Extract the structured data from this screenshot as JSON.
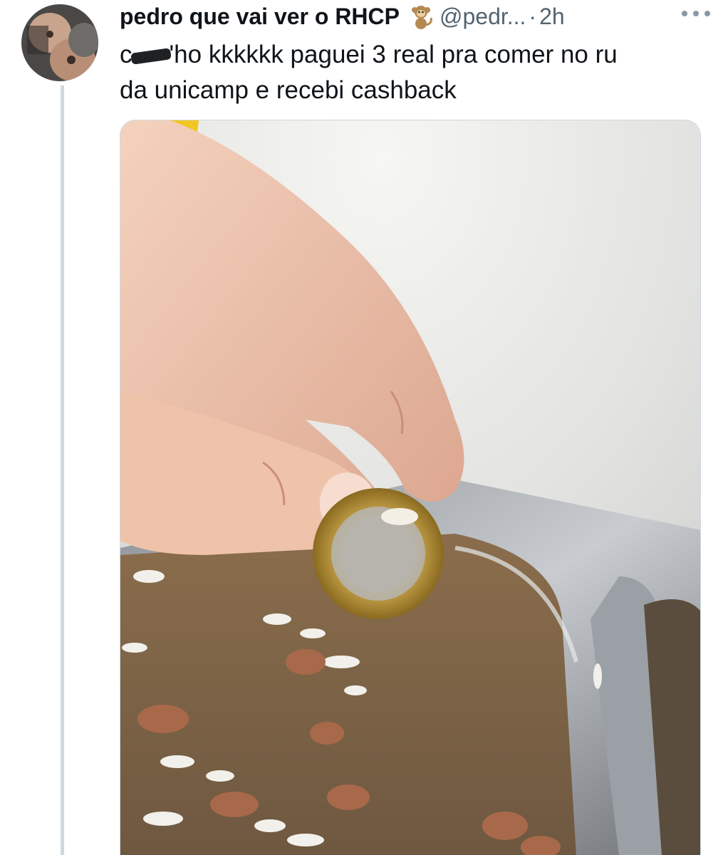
{
  "tweet": {
    "display_name": "pedro que vai ver o RHCP",
    "emoji_icon": "monkey-emoji-icon",
    "handle": "@pedr...",
    "separator": "·",
    "timestamp": "2h",
    "text_part1": "c",
    "text_part2": "'ho kkkkkk paguei 3 real pra comer no ru",
    "text_line2": "da unicamp e recebi cashback"
  },
  "icons": {
    "more": "more-options-icon"
  },
  "colors": {
    "text": "#0f1419",
    "secondary": "#536471",
    "thread_line": "#cfd9de"
  }
}
